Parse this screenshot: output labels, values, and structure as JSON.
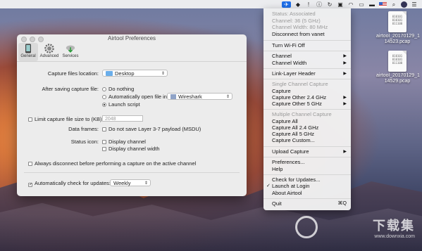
{
  "menubar": {
    "icons": [
      "airtool-icon",
      "dropbox-icon",
      "exclamation-icon",
      "info-icon",
      "sync-icon",
      "lock-icon",
      "wifi-icon",
      "airplay-icon",
      "battery-icon",
      "us-flag-icon",
      "search-icon",
      "user-avatar-icon",
      "list-icon"
    ]
  },
  "prefs": {
    "title": "Airtool Preferences",
    "tabs": [
      {
        "label": "General",
        "icon": "phone-icon"
      },
      {
        "label": "Advanced",
        "icon": "gear-icon"
      },
      {
        "label": "Services",
        "icon": "cloud-download-icon"
      }
    ],
    "capture_location_label": "Capture files location:",
    "capture_location_value": "Desktop",
    "after_saving_label": "After saving capture file:",
    "after_saving_options": [
      "Do nothing",
      "Automatically open file in:",
      "Launch script"
    ],
    "open_with_value": "Wireshark",
    "limit_size_label": "Limit capture file size to (KB):",
    "limit_size_placeholder": "2048",
    "data_frames_label": "Data frames:",
    "data_frames_option": "Do not save Layer 3-7 payload (MSDU)",
    "status_icon_label": "Status icon:",
    "status_icon_options": [
      "Display channel",
      "Display channel width"
    ],
    "always_disconnect": "Always disconnect before performing a capture on the active channel",
    "auto_check_label": "Automatically check for updates:",
    "auto_check_value": "Weekly"
  },
  "menu": {
    "status": "Status: Associated",
    "channel_info": "Channel: 36 (5 GHz)",
    "channel_width_info": "Channel Width: 80 MHz",
    "disconnect": "Disconnect from vanet",
    "turn_wifi_off": "Turn Wi-Fi Off",
    "channel": "Channel",
    "channel_width": "Channel Width",
    "link_layer_header": "Link-Layer Header",
    "single_channel_header": "Single Channel Capture",
    "capture": "Capture",
    "capture_other_24": "Capture Other 2.4 GHz",
    "capture_other_5": "Capture Other 5 GHz",
    "multiple_channel_header": "Multiple Channel Capture",
    "capture_all": "Capture All",
    "capture_all_24": "Capture All 2.4 GHz",
    "capture_all_5": "Capture All 5 GHz",
    "capture_custom": "Capture Custom...",
    "upload_capture": "Upload Capture",
    "preferences": "Preferences...",
    "help": "Help",
    "check_updates": "Check for Updates...",
    "launch_at_login": "Launch at Login",
    "about": "About Airtool",
    "quit": "Quit",
    "quit_shortcut": "⌘Q"
  },
  "desktop": {
    "files": [
      {
        "name_line1": "airtool_20170129_1",
        "name_line2": "14523.pcap",
        "icon_text": "010101 010101 011100"
      },
      {
        "name_line1": "airtool_20170129_1",
        "name_line2": "14529.pcap",
        "icon_text": "010101 010101 011100"
      }
    ]
  },
  "watermark": {
    "text": "下载集",
    "url": "www.downxia.com"
  },
  "colors": {
    "menubar_accent": "#1e6ee8",
    "folder": "#6aaeea"
  }
}
